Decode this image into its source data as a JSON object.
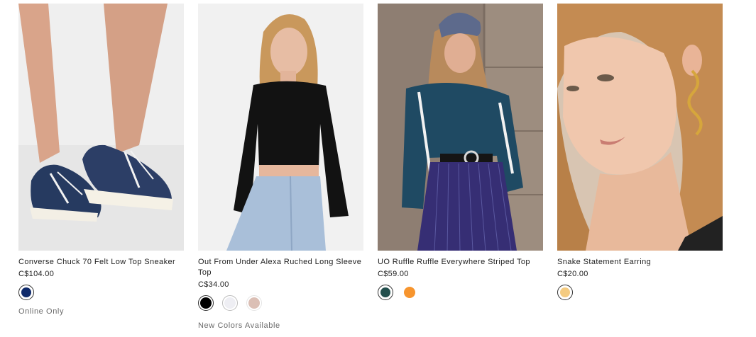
{
  "products": [
    {
      "title": "Converse Chuck 70 Felt Low Top Sneaker",
      "price": "C$104.00",
      "swatches": [
        {
          "name": "navy",
          "color": "#0f2a6b",
          "selected": true
        }
      ],
      "note": "Online Only"
    },
    {
      "title": "Out From Under Alexa Ruched Long Sleeve Top",
      "price": "C$34.00",
      "swatches": [
        {
          "name": "black",
          "color": "#000000",
          "selected": true
        },
        {
          "name": "white",
          "color": "#eeeef3",
          "selected": false
        },
        {
          "name": "blush",
          "color": "#dbbfb5",
          "selected": false
        }
      ],
      "note": "New Colors Available"
    },
    {
      "title": "UO Ruffle Ruffle Everywhere Striped Top",
      "price": "C$59.00",
      "swatches": [
        {
          "name": "teal",
          "color": "#234f4d",
          "selected": true
        },
        {
          "name": "orange",
          "color": "#f7952e",
          "selected": false
        }
      ],
      "note": ""
    },
    {
      "title": "Snake Statement Earring",
      "price": "C$20.00",
      "swatches": [
        {
          "name": "gold",
          "color": "#f4cb80",
          "selected": true
        }
      ],
      "note": ""
    }
  ]
}
